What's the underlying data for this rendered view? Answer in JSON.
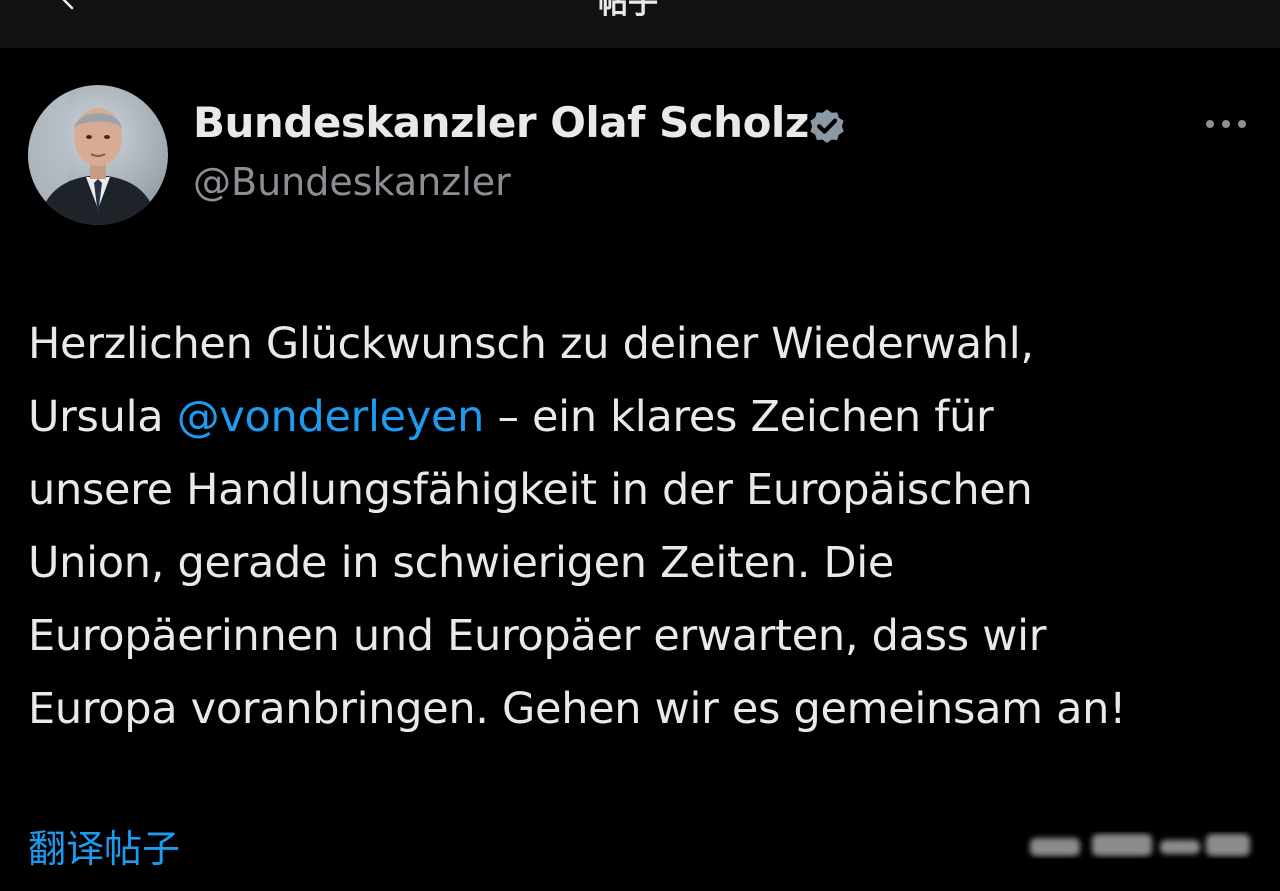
{
  "header": {
    "title": "帖子"
  },
  "tweet": {
    "author": {
      "display_name": "Bundeskanzler Olaf Scholz",
      "handle": "@Bundeskanzler",
      "verified": true
    },
    "lines": [
      {
        "before": "Herzlichen Glückwunsch zu deiner Wiederwahl,",
        "mention": "",
        "after": ""
      },
      {
        "before": "Ursula ",
        "mention": "@vonderleyen",
        "after": " – ein klares Zeichen für"
      },
      {
        "before": "unsere Handlungsfähigkeit in der Europäischen",
        "mention": "",
        "after": ""
      },
      {
        "before": "Union, gerade in schwierigen Zeiten. Die",
        "mention": "",
        "after": ""
      },
      {
        "before": "Europäerinnen und Europäer erwarten, dass wir",
        "mention": "",
        "after": ""
      },
      {
        "before": "Europa voranbringen. Gehen wir es gemeinsam an!",
        "mention": "",
        "after": ""
      }
    ],
    "translate_label": "翻译帖子"
  },
  "icons": {
    "back": "chevron-left-icon",
    "verified": "verified-badge-icon",
    "more": "more-horizontal-icon"
  },
  "colors": {
    "background": "#000000",
    "text": "#e7e9ea",
    "secondary_text": "#8b8f94",
    "link": "#1d9bf0",
    "verified_badge": "#8b98a5"
  }
}
